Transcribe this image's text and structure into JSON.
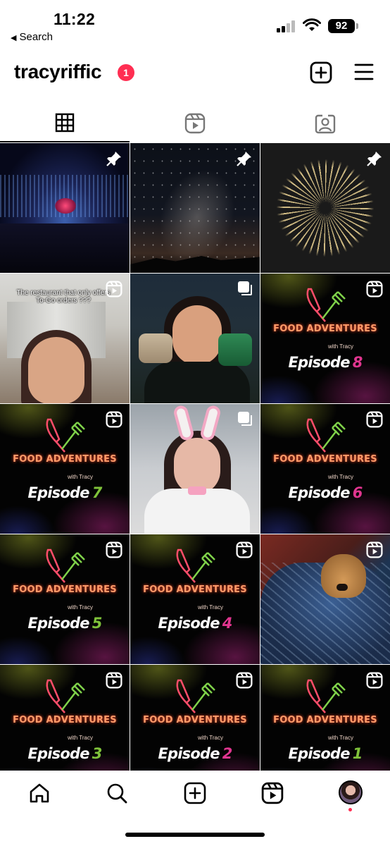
{
  "status_bar": {
    "time": "11:22",
    "back_label": "Search",
    "battery": "92"
  },
  "header": {
    "username": "tracyriffic",
    "notification_count": "1"
  },
  "tabs": [
    {
      "name": "grid",
      "icon": "grid-icon",
      "active": true
    },
    {
      "name": "reels",
      "icon": "reels-icon",
      "active": false
    },
    {
      "name": "tagged",
      "icon": "tagged-icon",
      "active": false
    }
  ],
  "posts": [
    {
      "type": "photo",
      "subject": "concert",
      "badge": "pin-icon"
    },
    {
      "type": "photo",
      "subject": "night-sky",
      "badge": "pin-icon"
    },
    {
      "type": "photo",
      "subject": "fireworks",
      "badge": "pin-icon"
    },
    {
      "type": "reel",
      "subject": "restaurant",
      "caption": "The restaurant that only offers To-Go orders ???",
      "badge": "reels-icon"
    },
    {
      "type": "carousel",
      "subject": "jars",
      "badge": "carousel-icon"
    },
    {
      "type": "reel",
      "subject": "food-adventures",
      "badge": "reels-icon",
      "title": "FOOD ADVENTURES",
      "subtitle": "with Tracy",
      "episode_label": "Episode",
      "episode_number": "8",
      "number_color": "#e0358f"
    },
    {
      "type": "reel",
      "subject": "food-adventures",
      "badge": "reels-icon",
      "title": "FOOD ADVENTURES",
      "subtitle": "with Tracy",
      "episode_label": "Episode",
      "episode_number": "7",
      "number_color": "#7fc23a"
    },
    {
      "type": "carousel",
      "subject": "bunny",
      "badge": "carousel-icon"
    },
    {
      "type": "reel",
      "subject": "food-adventures",
      "badge": "reels-icon",
      "title": "FOOD ADVENTURES",
      "subtitle": "with Tracy",
      "episode_label": "Episode",
      "episode_number": "6",
      "number_color": "#e0358f"
    },
    {
      "type": "reel",
      "subject": "food-adventures",
      "badge": "reels-icon",
      "title": "FOOD ADVENTURES",
      "subtitle": "with Tracy",
      "episode_label": "Episode",
      "episode_number": "5",
      "number_color": "#7fc23a"
    },
    {
      "type": "reel",
      "subject": "food-adventures",
      "badge": "reels-icon",
      "title": "FOOD ADVENTURES",
      "subtitle": "with Tracy",
      "episode_label": "Episode",
      "episode_number": "4",
      "number_color": "#e0358f"
    },
    {
      "type": "reel",
      "subject": "dog",
      "badge": "reels-icon"
    },
    {
      "type": "reel",
      "subject": "food-adventures",
      "badge": "reels-icon",
      "title": "FOOD ADVENTURES",
      "subtitle": "with Tracy",
      "episode_label": "Episode",
      "episode_number": "3",
      "number_color": "#7fc23a"
    },
    {
      "type": "reel",
      "subject": "food-adventures",
      "badge": "reels-icon",
      "title": "FOOD ADVENTURES",
      "subtitle": "with Tracy",
      "episode_label": "Episode",
      "episode_number": "2",
      "number_color": "#e0358f"
    },
    {
      "type": "reel",
      "subject": "food-adventures",
      "badge": "reels-icon",
      "title": "FOOD ADVENTURES",
      "subtitle": "with Tracy",
      "episode_label": "Episode",
      "episode_number": "1",
      "number_color": "#7fc23a"
    }
  ],
  "bottom_nav": [
    {
      "name": "home",
      "icon": "home-icon"
    },
    {
      "name": "search",
      "icon": "search-icon"
    },
    {
      "name": "create",
      "icon": "create-icon"
    },
    {
      "name": "reels",
      "icon": "reels-icon"
    },
    {
      "name": "profile",
      "icon": "avatar"
    }
  ],
  "colors": {
    "notification": "#ff2e52",
    "episode_pink": "#e0358f",
    "episode_green": "#7fc23a",
    "food_title": "#ff9c6a"
  }
}
